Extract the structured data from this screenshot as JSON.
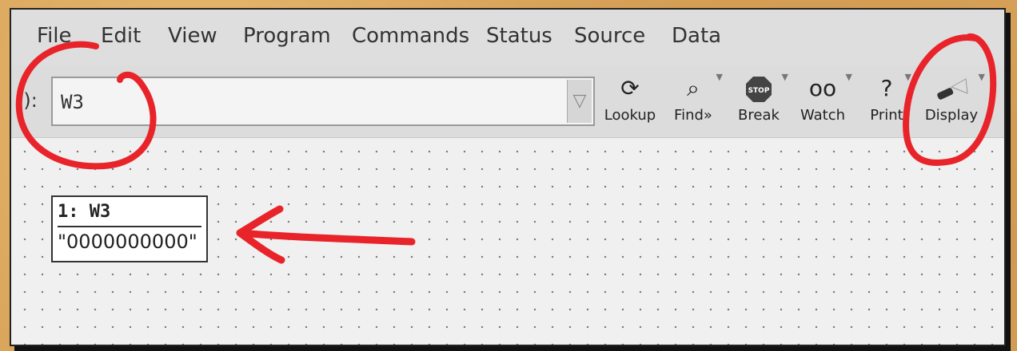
{
  "menu": {
    "file": "File",
    "edit": "Edit",
    "view": "View",
    "program": "Program",
    "commands": "Commands",
    "status": "Status",
    "source": "Source",
    "data": "Data"
  },
  "toolbar": {
    "expression_label": "():",
    "expression_value": "W3",
    "lookup": "Lookup",
    "find": "Find»",
    "break": "Break",
    "watch": "Watch",
    "print": "Print",
    "display": "Display"
  },
  "display": {
    "title": "1: W3",
    "value": "\"0000000000\""
  },
  "annotation_color": "#e8242a"
}
